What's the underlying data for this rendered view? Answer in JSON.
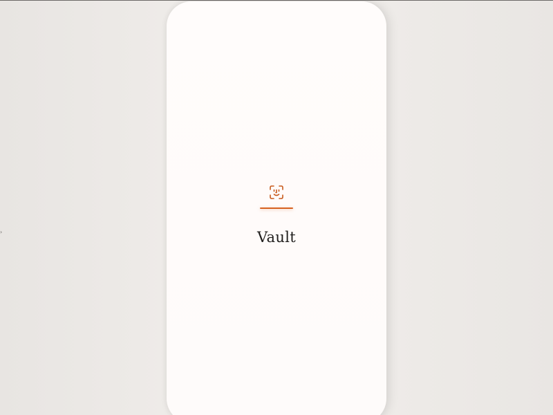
{
  "app": {
    "name": "Vault"
  },
  "splash": {
    "icon": "face-id-icon",
    "accent_color": "#d7611f"
  },
  "colors": {
    "background": "#eeebe8",
    "screen": "#fffbfa",
    "text": "#1f1d1c"
  }
}
